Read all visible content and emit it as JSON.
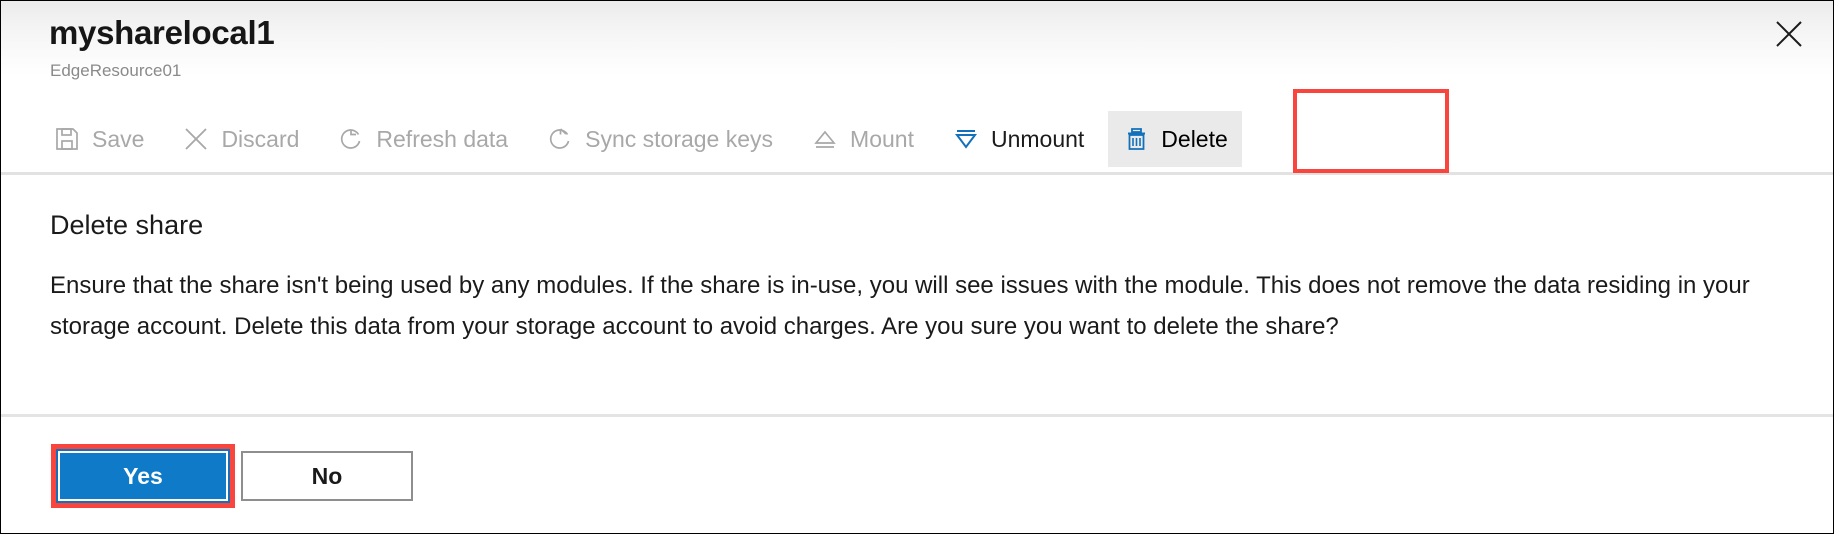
{
  "header": {
    "title": "mysharelocal1",
    "subtitle": "EdgeResource01",
    "close_icon": "close-icon"
  },
  "toolbar": {
    "commands": [
      {
        "label": "Save",
        "icon": "save-floppy-icon",
        "state": "disabled"
      },
      {
        "label": "Discard",
        "icon": "close-x-icon",
        "state": "disabled"
      },
      {
        "label": "Refresh data",
        "icon": "refresh-icon",
        "state": "disabled"
      },
      {
        "label": "Sync storage keys",
        "icon": "sync-icon",
        "state": "disabled"
      },
      {
        "label": "Mount",
        "icon": "mount-eject-icon",
        "state": "disabled"
      },
      {
        "label": "Unmount",
        "icon": "unmount-eject-icon",
        "state": "enabled"
      },
      {
        "label": "Delete",
        "icon": "trash-icon",
        "state": "active"
      }
    ]
  },
  "content": {
    "heading": "Delete share",
    "paragraph": "Ensure that the share isn't being used by any modules. If the share is in-use, you will see issues with the module. This does not remove the data residing in your storage account. Delete this data from your storage account to avoid charges. Are you sure you want to delete the share?"
  },
  "footer": {
    "confirm_label": "Yes",
    "cancel_label": "No"
  },
  "colors": {
    "accent_blue": "#0f7ac8",
    "icon_blue": "#1271ba",
    "highlight_red": "#f8463f",
    "disabled_gray": "#a8a8a8",
    "text_dark": "#1a1a1a"
  }
}
